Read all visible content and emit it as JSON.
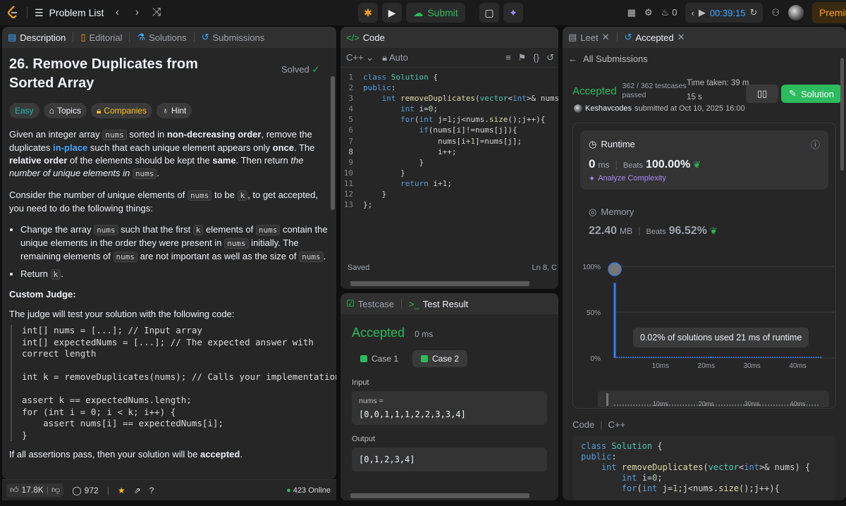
{
  "topbar": {
    "problem_list": "Problem List",
    "submit": "Submit",
    "streak": "0",
    "timer": "00:39:15",
    "premium": "Premium"
  },
  "left": {
    "tabs": [
      "Description",
      "Editorial",
      "Solutions",
      "Submissions"
    ],
    "title": "26. Remove Duplicates from Sorted Array",
    "solved": "Solved",
    "tags": [
      "Easy",
      "Topics",
      "Companies",
      "Hint"
    ],
    "likes": "17.8K",
    "comments": "972",
    "online": "423 Online",
    "custom_judge": "Custom Judge:",
    "judge_intro": "The judge will test your solution with the following code:",
    "judge_code": "int[] nums = [...]; // Input array\nint[] expectedNums = [...]; // The expected answer with\ncorrect length\n\nint k = removeDuplicates(nums); // Calls your implementation\n\nassert k == expectedNums.length;\nfor (int i = 0; i < k; i++) {\n    assert nums[i] == expectedNums[i];\n}",
    "final_pre": "If all assertions pass, then your solution will be ",
    "final_bold": "accepted",
    "final_post": "."
  },
  "code": {
    "tab": "Code",
    "lang": "C++",
    "mode": "Auto",
    "saved": "Saved",
    "cursor": "Ln 8, C",
    "lines": [
      "class Solution {",
      "public:",
      "    int removeDuplicates(vector<int>& nums)",
      "        int i=0;",
      "        for(int j=1;j<nums.size();j++){",
      "            if(nums[i]!=nums[j]){",
      "                nums[i+1]=nums[j];",
      "                i++;",
      "            }",
      "        }",
      "        return i+1;",
      "    }",
      "};"
    ]
  },
  "test": {
    "tabs": [
      "Testcase",
      "Test Result"
    ],
    "status": "Accepted",
    "runtime": "0 ms",
    "cases": [
      "Case 1",
      "Case 2"
    ],
    "input_label": "Input",
    "input_var": "nums =",
    "input_value": "[0,0,1,1,1,2,2,3,3,4]",
    "output_label": "Output",
    "output_value": "[0,1,2,3,4]"
  },
  "result": {
    "tabs": [
      "Leet",
      "Accepted"
    ],
    "back": "All Submissions",
    "status": "Accepted",
    "testcases": "362 / 362 testcases",
    "passed": "passed",
    "time_taken_label": "Time taken: 39 m",
    "time_taken_sec": "15 s",
    "solution_btn": "Solution",
    "user": "Keshavcodes",
    "submitted": "submitted at Oct 10, 2025 16:00",
    "runtime_label": "Runtime",
    "runtime_value": "0",
    "runtime_unit": "ms",
    "beats_label": "Beats",
    "runtime_beats": "100.00%",
    "analyze": "Analyze Complexity",
    "memory_label": "Memory",
    "memory_value": "22.40",
    "memory_unit": "MB",
    "memory_beats": "96.52%",
    "tooltip": "0.02% of solutions used 21 ms of runtime",
    "code_label": "Code",
    "code_lang": "C++",
    "code_preview": [
      "class Solution {",
      "public:",
      "    int removeDuplicates(vector<int>& nums) {",
      "        int i=0;",
      "        for(int j=1;j<nums.size();j++){"
    ]
  },
  "chart_data": {
    "type": "bar",
    "title": "",
    "xlabel": "",
    "ylabel": "",
    "y_ticks": [
      "100%",
      "50%",
      "0%"
    ],
    "x_ticks": [
      "10ms",
      "20ms",
      "30ms",
      "40ms"
    ],
    "ylim": [
      0,
      100
    ],
    "xlim": [
      0,
      45
    ],
    "series": [
      {
        "values": [
          {
            "x": 0,
            "y": 82
          },
          {
            "x": 21,
            "y": 0.02
          }
        ]
      }
    ],
    "colors": {
      "bar": "#2f80ed",
      "grid": "#3e3e3e"
    }
  }
}
